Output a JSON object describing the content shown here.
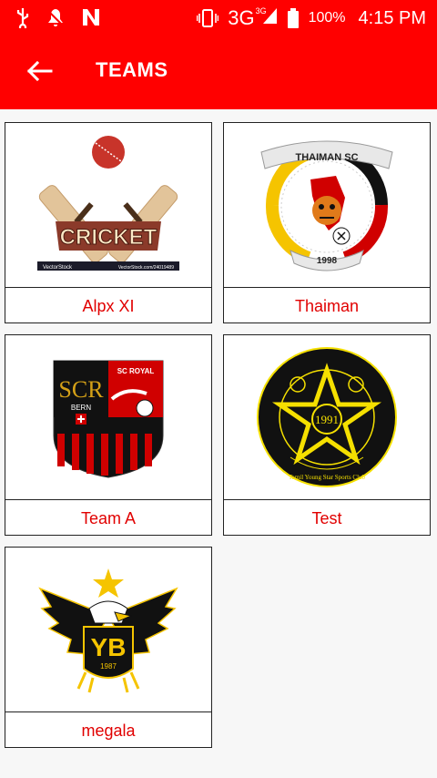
{
  "status_bar": {
    "network": "3G",
    "network_sup": "3G",
    "battery": "100%",
    "time": "4:15 PM"
  },
  "appbar": {
    "title": "TEAMS"
  },
  "teams": [
    {
      "name": "Alpx XI",
      "logo_text": "CRICKET",
      "logo_caption_left": "VectorStock",
      "logo_caption_right": "VectorStock.com/24019489"
    },
    {
      "name": "Thaiman",
      "logo_text": "THAIMAN SC",
      "logo_year": "1998"
    },
    {
      "name": "Team A",
      "logo_text": "SCR",
      "logo_sub": "BERN",
      "logo_right": "SC ROYAL"
    },
    {
      "name": "Test",
      "logo_year": "1991",
      "logo_ring": "Tamil Young Star Sports Club"
    },
    {
      "name": "megala",
      "logo_text": "YB",
      "logo_year": "1987"
    }
  ],
  "colors": {
    "primary": "#ff0000",
    "team_name": "#e10000",
    "background": "#f7f7f7"
  }
}
